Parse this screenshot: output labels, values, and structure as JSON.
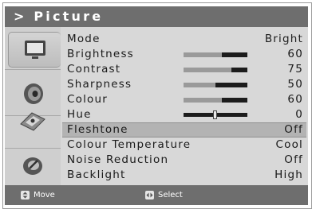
{
  "title": "> Picture",
  "menu": [
    {
      "label": "Mode",
      "value": "Bright"
    },
    {
      "label": "Brightness",
      "value": "60",
      "level": 0.6
    },
    {
      "label": "Contrast",
      "value": "75",
      "level": 0.75
    },
    {
      "label": "Sharpness",
      "value": "50",
      "level": 0.5
    },
    {
      "label": "Colour",
      "value": "60",
      "level": 0.6
    },
    {
      "label": "Hue",
      "value": "0"
    },
    {
      "label": "Fleshtone",
      "value": "Off",
      "selected": true
    },
    {
      "label": "Colour Temperature",
      "value": "Cool"
    },
    {
      "label": "Noise Reduction",
      "value": "Off"
    },
    {
      "label": "Backlight",
      "value": "High"
    }
  ],
  "sidebar_icons": [
    "picture-icon",
    "sound-icon",
    "satellite-icon",
    "setup-icon"
  ],
  "footer": {
    "move_label": "Move",
    "select_label": "Select"
  },
  "colors": {
    "titlebar": "#6e6e6e",
    "panel": "#d8d8d8",
    "selected_row": "#b3b3b3"
  }
}
